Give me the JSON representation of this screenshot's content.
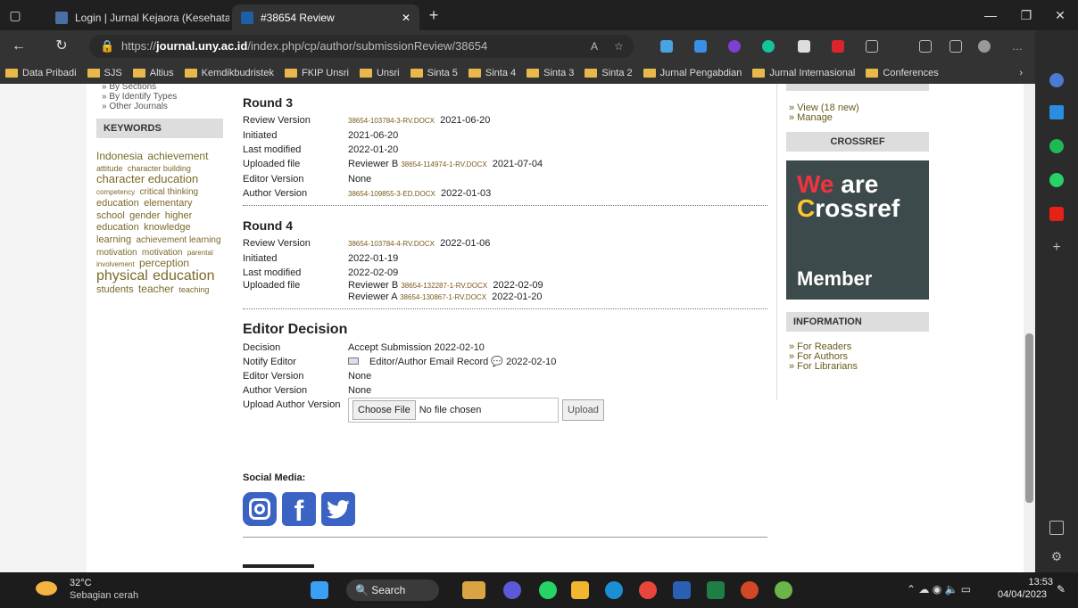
{
  "browser": {
    "tabs": [
      {
        "title": "Login | Jurnal Kejaora (Kesehatan",
        "active": false
      },
      {
        "title": "#38654 Review",
        "active": true
      }
    ],
    "new_tab": "+",
    "url_prefix": "https://",
    "url_host": "journal.uny.ac.id",
    "url_path": "/index.php/cp/author/submissionReview/38654",
    "bookmarks": [
      "Data Pribadi",
      "SJS",
      "Altius",
      "Kemdikbudristek",
      "FKIP Unsri",
      "Unsri",
      "Sinta 5",
      "Sinta 4",
      "Sinta 3",
      "Sinta 2",
      "Jurnal Pengabdian",
      "Jurnal Internasional",
      "Conferences"
    ]
  },
  "left": {
    "links": [
      "» By Sections",
      "» By Identify Types",
      "» Other Journals"
    ],
    "keywords_title": "KEYWORDS",
    "keywords": [
      {
        "text": "Indonesia",
        "size": 12
      },
      {
        "text": "achievement",
        "size": 12
      },
      {
        "text": "attitude",
        "size": 9
      },
      {
        "text": "character building",
        "size": 9
      },
      {
        "text": "character education",
        "size": 13
      },
      {
        "text": "competency",
        "size": 8
      },
      {
        "text": "critical thinking",
        "size": 10
      },
      {
        "text": "education",
        "size": 11
      },
      {
        "text": "elementary school",
        "size": 11
      },
      {
        "text": "gender",
        "size": 11
      },
      {
        "text": "higher education",
        "size": 11
      },
      {
        "text": "knowledge",
        "size": 11
      },
      {
        "text": "learning",
        "size": 11
      },
      {
        "text": "achievement learning",
        "size": 10
      },
      {
        "text": "motivation",
        "size": 10
      },
      {
        "text": "motivation",
        "size": 10
      },
      {
        "text": "parental involvement",
        "size": 8
      },
      {
        "text": "perception",
        "size": 12
      },
      {
        "text": "physical",
        "size": 16
      },
      {
        "text": "education",
        "size": 16
      },
      {
        "text": "students",
        "size": 11
      },
      {
        "text": "teacher",
        "size": 12
      },
      {
        "text": "teaching",
        "size": 9
      }
    ]
  },
  "rounds": [
    {
      "title": "Round 3",
      "review_label": "Review Version",
      "review_file": "38654-103784-3-RV.DOCX",
      "review_date": "2021-06-20",
      "initiated_label": "Initiated",
      "initiated": "2021-06-20",
      "modified_label": "Last modified",
      "modified": "2022-01-20",
      "uploaded_label": "Uploaded file",
      "uploads": [
        {
          "reviewer": "Reviewer B",
          "file": "38654-114974-1-RV.DOCX",
          "date": "2021-07-04"
        }
      ],
      "editor_label": "Editor Version",
      "editor": "None",
      "author_label": "Author Version",
      "author_file": "38654-109855-3-ED.DOCX",
      "author_date": "2022-01-03"
    },
    {
      "title": "Round 4",
      "review_label": "Review Version",
      "review_file": "38654-103784-4-RV.DOCX",
      "review_date": "2022-01-06",
      "initiated_label": "Initiated",
      "initiated": "2022-01-19",
      "modified_label": "Last modified",
      "modified": "2022-02-09",
      "uploaded_label": "Uploaded file",
      "uploads": [
        {
          "reviewer": "Reviewer B",
          "file": "38654-132287-1-RV.DOCX",
          "date": "2022-02-09"
        },
        {
          "reviewer": "Reviewer A",
          "file": "38654-130867-1-RV.DOCX",
          "date": "2022-01-20"
        }
      ]
    }
  ],
  "decision": {
    "title": "Editor Decision",
    "decision_label": "Decision",
    "decision": "Accept Submission 2022-02-10",
    "notify_label": "Notify Editor",
    "notify_text": "Editor/Author Email Record",
    "notify_date": "2022-02-10",
    "editor_label": "Editor Version",
    "editor": "None",
    "author_label": "Author Version",
    "author": "None",
    "upload_label": "Upload Author Version",
    "choose_file": "Choose File",
    "no_file": "No file chosen",
    "upload_btn": "Upload"
  },
  "social": {
    "title": "Social Media:"
  },
  "right": {
    "links_top": [
      "» View (18 new)",
      "» Manage"
    ],
    "crossref_head": "CROSSREF",
    "crossref_line1a": "We",
    "crossref_line1b": " are",
    "crossref_line2a": "C",
    "crossref_line2b": "rossref",
    "crossref_member": "Member",
    "info_head": "INFORMATION",
    "info_links": [
      "» For Readers",
      "» For Authors",
      "» For Librarians"
    ]
  },
  "taskbar": {
    "temp": "32°C",
    "weather": "Sebagian cerah",
    "search": "Search",
    "time": "13:53",
    "date": "04/04/2023"
  }
}
